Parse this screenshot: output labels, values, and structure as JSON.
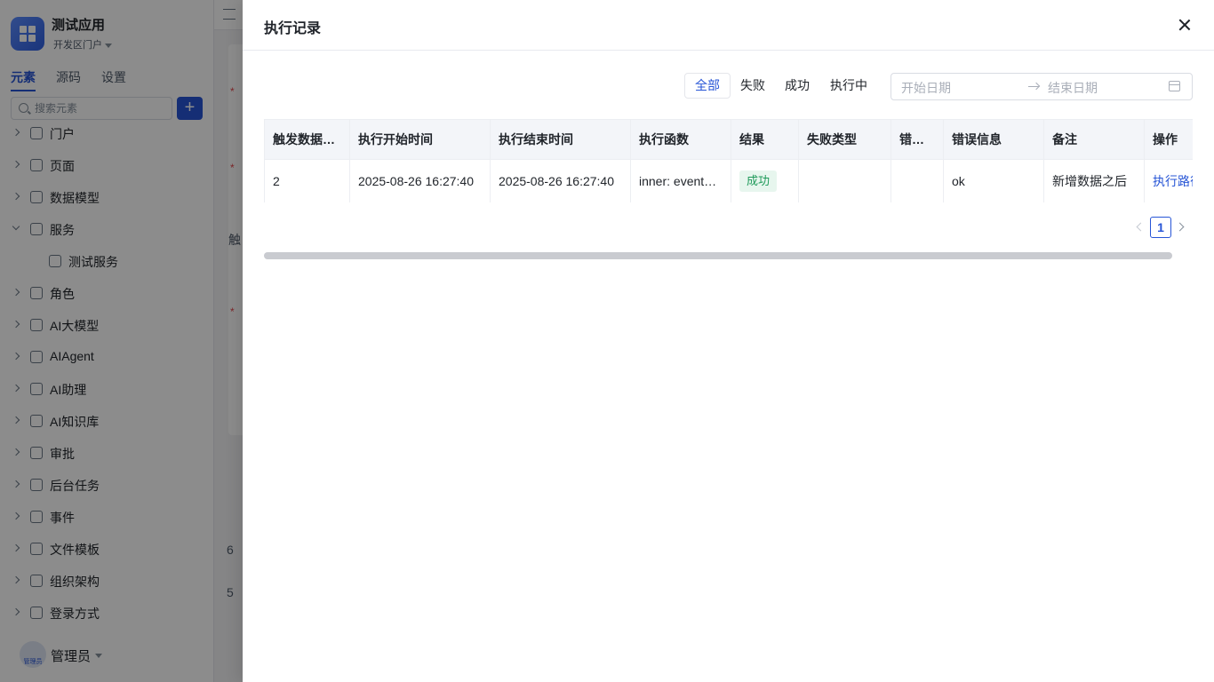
{
  "app": {
    "name": "测试应用",
    "portal": "开发区门户"
  },
  "sidebar": {
    "tabs": [
      "元素",
      "源码",
      "设置"
    ],
    "search_placeholder": "搜索元素",
    "add_label": "+",
    "items": [
      {
        "label": "门户",
        "icon": "home-icon",
        "expanded": false
      },
      {
        "label": "页面",
        "icon": "page-icon",
        "expanded": false
      },
      {
        "label": "数据模型",
        "icon": "table-icon",
        "expanded": false
      },
      {
        "label": "服务",
        "icon": "service-icon",
        "expanded": true
      },
      {
        "label": "测试服务",
        "icon": "service-icon",
        "child": true
      },
      {
        "label": "角色",
        "icon": "role-icon",
        "expanded": false
      },
      {
        "label": "AI大模型",
        "icon": "ai-model-icon",
        "expanded": false
      },
      {
        "label": "AIAgent",
        "icon": "robot-icon",
        "expanded": false
      },
      {
        "label": "AI助理",
        "icon": "ai-assistant-icon",
        "expanded": false
      },
      {
        "label": "AI知识库",
        "icon": "book-icon",
        "expanded": false
      },
      {
        "label": "审批",
        "icon": "stamp-icon",
        "expanded": false
      },
      {
        "label": "后台任务",
        "icon": "task-icon",
        "expanded": false
      },
      {
        "label": "事件",
        "icon": "event-icon",
        "expanded": false
      },
      {
        "label": "文件模板",
        "icon": "file-icon",
        "expanded": false
      },
      {
        "label": "组织架构",
        "icon": "org-icon",
        "expanded": false
      },
      {
        "label": "登录方式",
        "icon": "login-icon",
        "expanded": false
      }
    ],
    "user": {
      "name": "管理员",
      "avatar_text": "管理员"
    }
  },
  "background": {
    "marks": [
      "*",
      "*",
      "触",
      "*",
      "6",
      "5"
    ]
  },
  "drawer": {
    "title": "执行记录",
    "filters": [
      "全部",
      "失败",
      "成功",
      "执行中"
    ],
    "active_filter": "全部",
    "date_range": {
      "start_placeholder": "开始日期",
      "end_placeholder": "结束日期"
    },
    "table": {
      "columns": [
        "触发数据主键",
        "执行开始时间",
        "执行结束时间",
        "执行函数",
        "结果",
        "失败类型",
        "错误码",
        "错误信息",
        "备注",
        "操作"
      ],
      "rows": [
        {
          "key": "2",
          "start": "2025-08-26 16:27:40",
          "end": "2025-08-26 16:27:40",
          "func": "inner: events.after_insert",
          "result": "成功",
          "fail_type": "",
          "error_code": "",
          "error_msg": "ok",
          "remark": "新增数据之后",
          "action": "执行路径"
        }
      ]
    },
    "pagination": {
      "current": "1"
    }
  },
  "colors": {
    "accent": "#2755d6",
    "success_text": "#1f9a5a",
    "success_bg": "#e7f6ee"
  }
}
